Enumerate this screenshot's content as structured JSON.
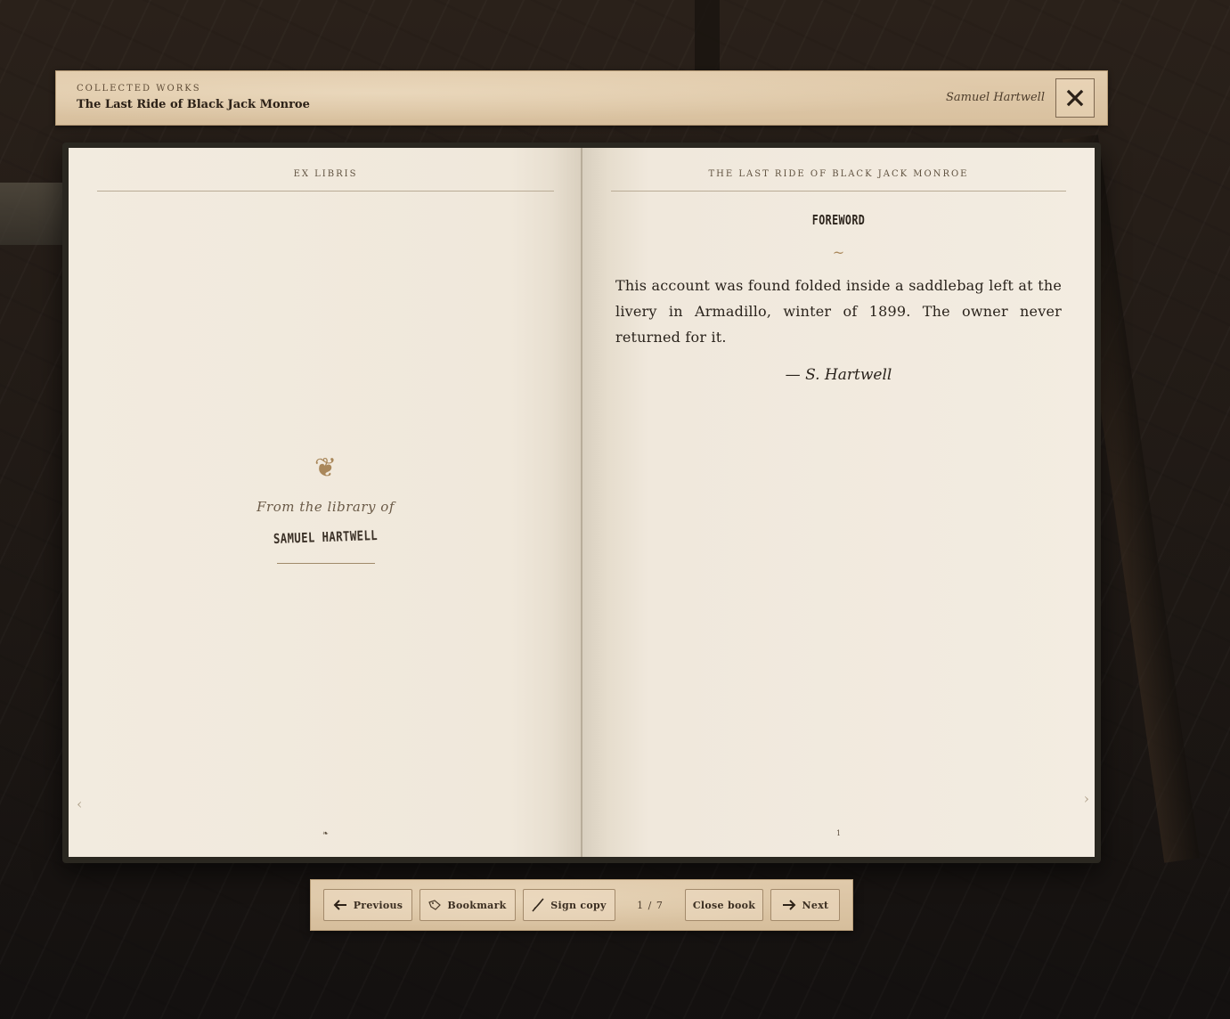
{
  "header": {
    "kicker": "COLLECTED WORKS",
    "title": "The Last Ride of Black Jack Monroe",
    "author": "Samuel Hartwell",
    "close_icon": "close-x-icon"
  },
  "left_page": {
    "running_head": "EX LIBRIS",
    "fleuron": "❦",
    "library_line": "From the library of",
    "owner_name": "SAMUEL HARTWELL",
    "folio": "❧",
    "turn_arrow": "‹"
  },
  "right_page": {
    "running_head": "THE LAST RIDE OF BLACK JACK MONROE",
    "chapter_title": "FOREWORD",
    "ornament": "~",
    "body": "This account was found folded inside a saddlebag left at the livery in Armadillo, winter of 1899. The owner never returned for it.",
    "signoff": "— S. Hartwell",
    "folio": "1",
    "turn_arrow": "›"
  },
  "toolbar": {
    "previous_label": "Previous",
    "bookmark_label": "Bookmark",
    "sign_label": "Sign copy",
    "page_count": "1 / 7",
    "close_label": "Close book",
    "next_label": "Next"
  },
  "colors": {
    "parchment": "#e0caab",
    "page": "#f2ebdf",
    "ink": "#2a231c",
    "accent_gold": "#a9875a"
  }
}
